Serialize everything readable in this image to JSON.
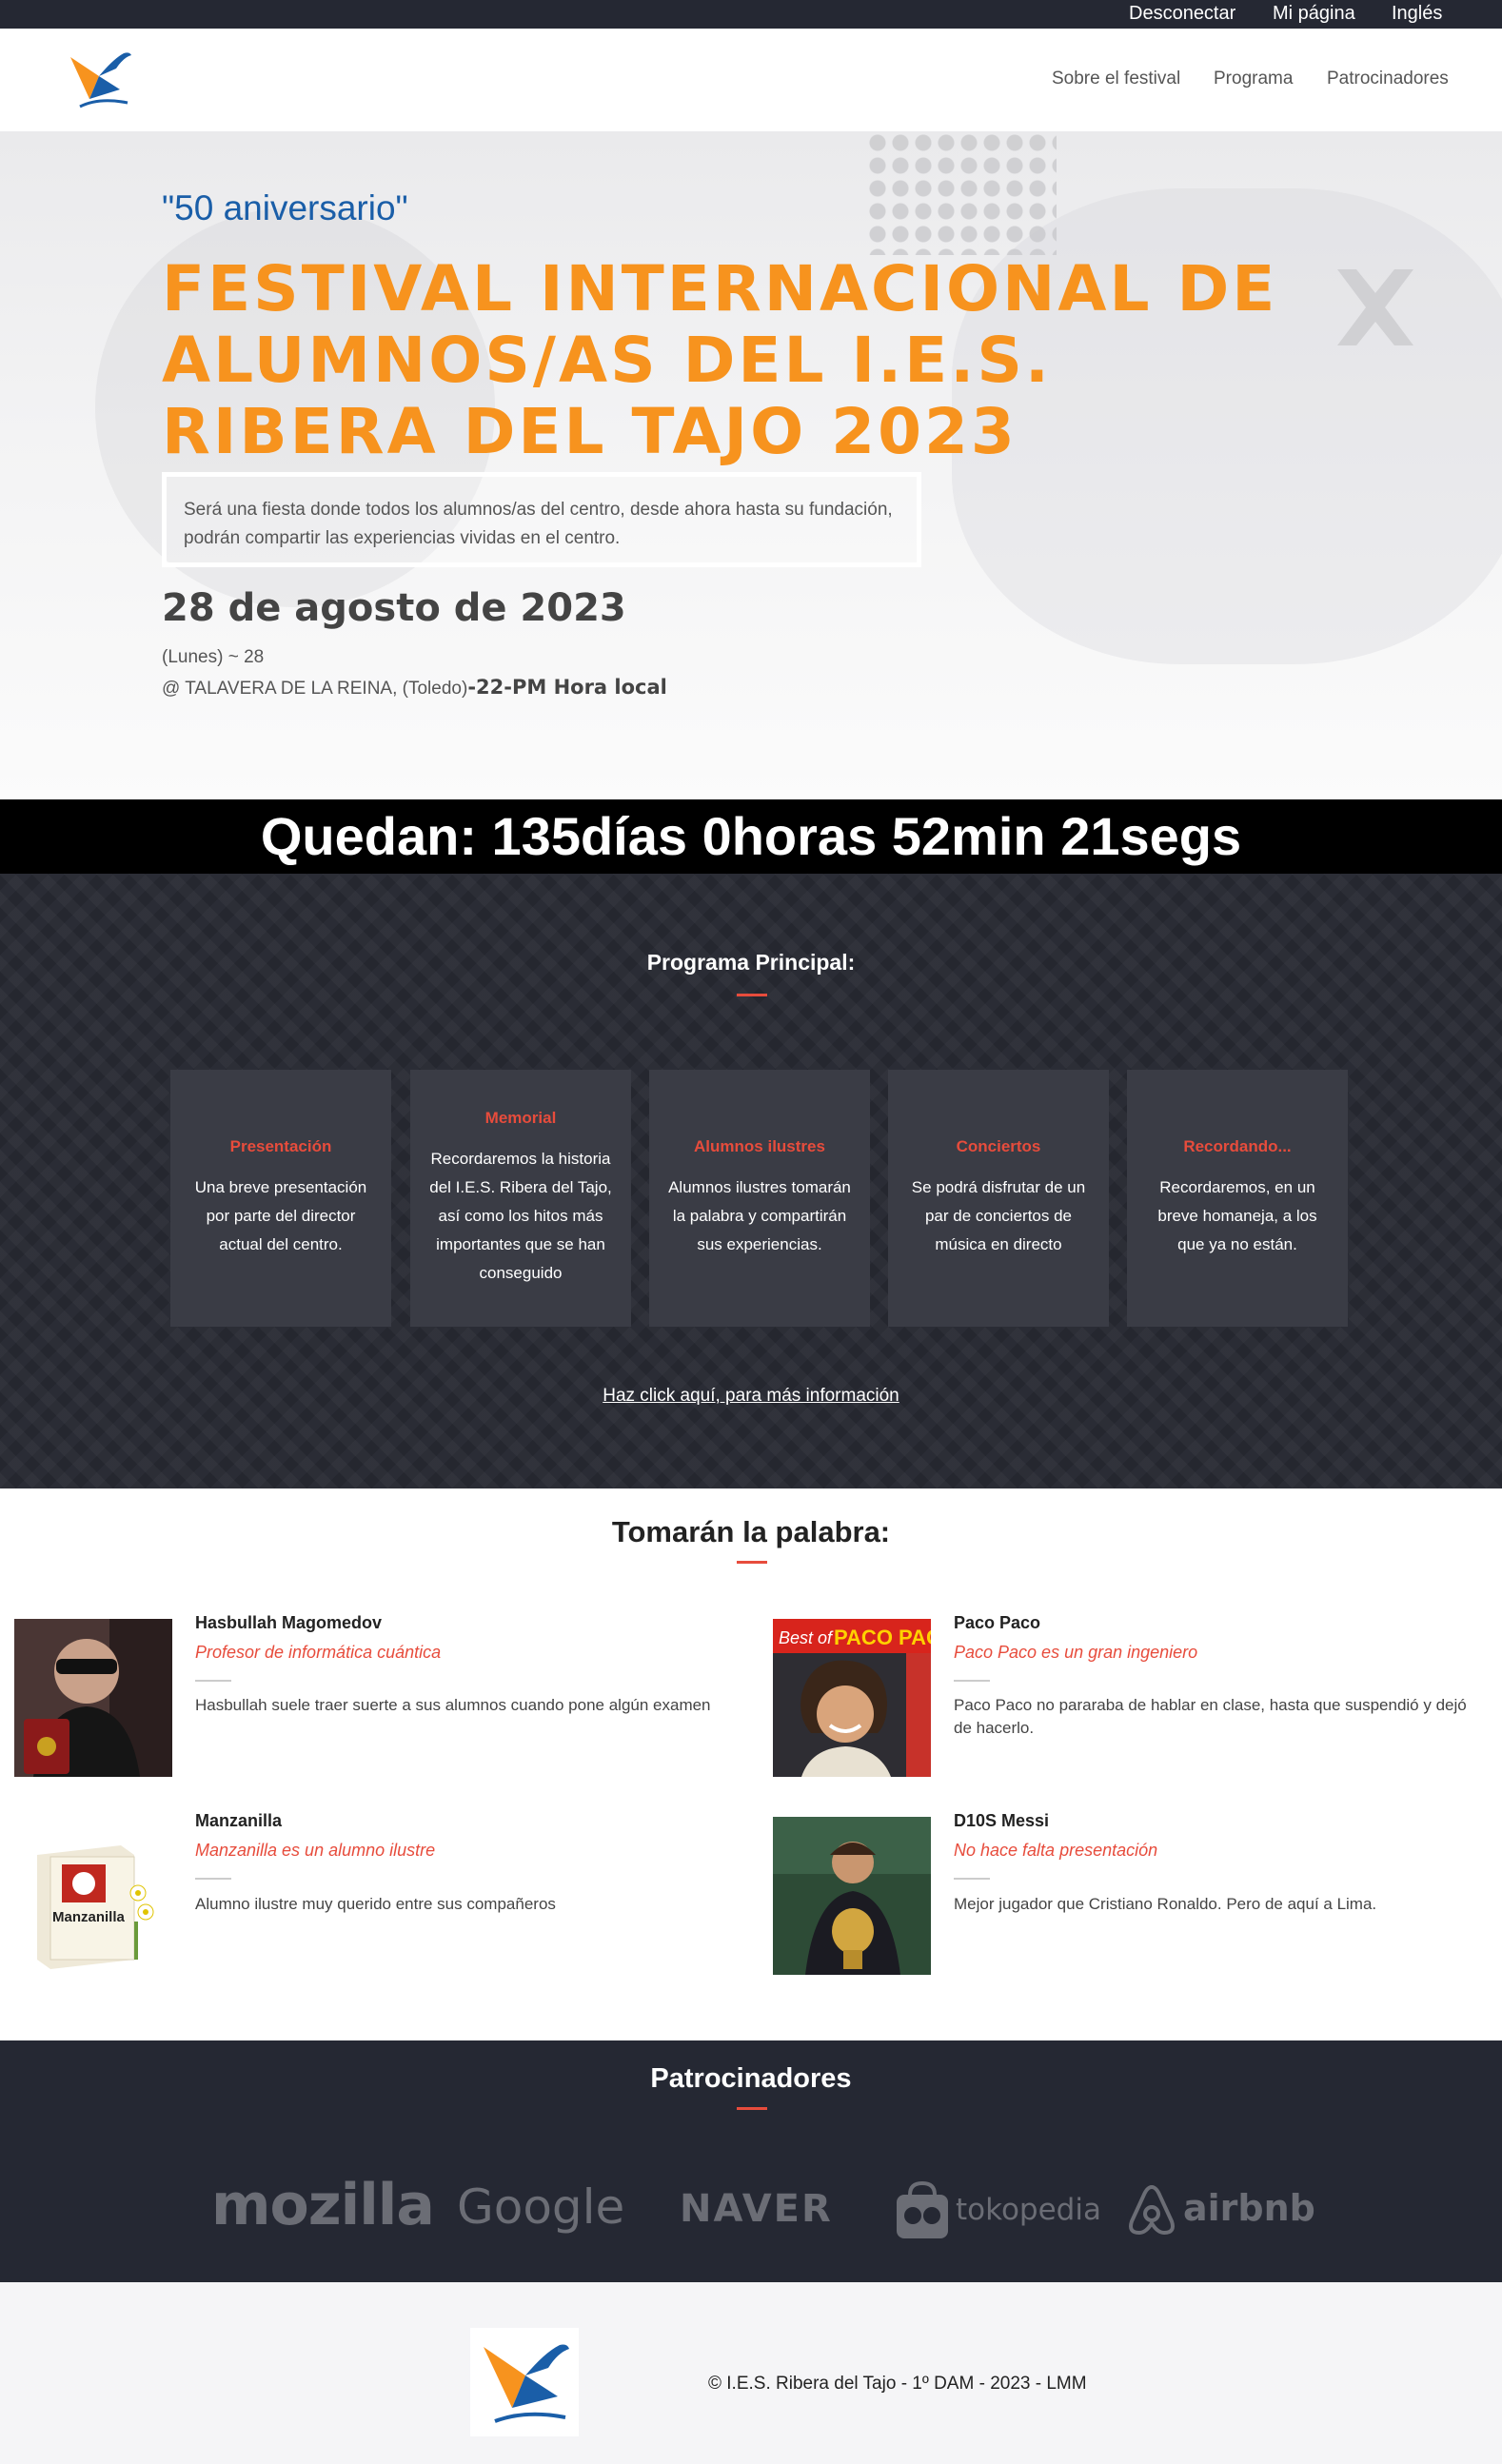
{
  "topbar": {
    "logout": "Desconectar",
    "my_page": "Mi página",
    "language": "Inglés"
  },
  "nav": {
    "about": "Sobre el festival",
    "program": "Programa",
    "sponsors": "Patrocinadores"
  },
  "hero": {
    "anniversary": "\"50 aniversario\"",
    "title": "FESTIVAL INTERNACIONAL DE ALUMNOS/AS DEL I.E.S. RIBERA DEL TAJO 2023",
    "description": "Será una fiesta donde todos los alumnos/as del centro, desde ahora hasta su fundación, podrán compartir las experiencias vividas en el centro.",
    "date": "28 de agosto de 2023",
    "day": "(Lunes) ~ 28",
    "location": "@ TALAVERA DE LA REINA, (Toledo)",
    "time": "-22-PM Hora local"
  },
  "countdown": "Quedan: 135días 0horas 52min 21segs",
  "program": {
    "title": "Programa Principal:",
    "cards": [
      {
        "title": "Presentación",
        "desc": "Una breve presentación por parte del director actual del centro."
      },
      {
        "title": "Memorial",
        "desc": "Recordaremos la historia del I.E.S. Ribera del Tajo, así como los hitos más importantes que se han conseguido"
      },
      {
        "title": "Alumnos ilustres",
        "desc": "Alumnos ilustres tomarán la palabra y compartirán sus experiencias."
      },
      {
        "title": "Conciertos",
        "desc": "Se podrá disfrutar de un par de conciertos de música en directo"
      },
      {
        "title": "Recordando...",
        "desc": "Recordaremos, en un breve homaneja, a los que ya no están."
      }
    ],
    "more_link": "Haz click aquí, para más información"
  },
  "speakers": {
    "title": "Tomarán la palabra:",
    "items": [
      {
        "name": "Hasbullah Magomedov",
        "role": "Profesor de informática cuántica",
        "desc": "Hasbullah suele traer suerte a sus alumnos cuando pone algún examen"
      },
      {
        "name": "Paco Paco",
        "role": "Paco Paco es un gran ingeniero",
        "desc": "Paco Paco no pararaba de hablar en clase, hasta que suspendió y dejó de hacerlo."
      },
      {
        "name": "Manzanilla",
        "role": "Manzanilla es un alumno ilustre",
        "desc": "Alumno ilustre muy querido entre sus compañeros"
      },
      {
        "name": "D10S Messi",
        "role": "No hace falta presentación",
        "desc": "Mejor jugador que Cristiano Ronaldo. Pero de aquí a Lima."
      }
    ],
    "photo_text": {
      "paco_banner_a": "Best of",
      "paco_banner_b": "PACO PACO",
      "manzanilla_box": "Manzanilla"
    }
  },
  "sponsors": {
    "title": "Patrocinadores",
    "brands": [
      "mozilla",
      "Google",
      "NAVER",
      "tokopedia",
      "airbnb"
    ]
  },
  "footer": {
    "copyright": "© I.E.S. Ribera del Tajo - 1º DAM - 2023 - LMM"
  },
  "colors": {
    "accent": "#f7931e",
    "red": "#e74c3c",
    "dark": "#252833",
    "blue": "#1a5ea8"
  }
}
